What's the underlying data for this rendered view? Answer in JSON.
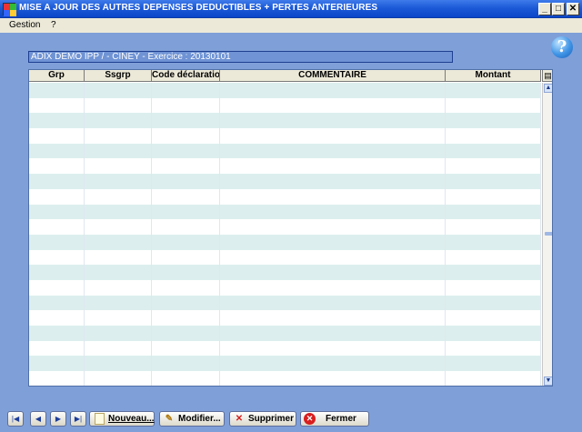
{
  "window": {
    "title": "MISE A JOUR  DES AUTRES DEPENSES DEDUCTIBLES + PERTES ANTERIEURES",
    "min_symbol": "_",
    "max_symbol": "□",
    "close_symbol": "✕"
  },
  "menu": {
    "gestion": "Gestion",
    "help": "?"
  },
  "help_icon_glyph": "?",
  "context": {
    "info": "ADIX DEMO IPP /     - CINEY - Exercice : 20130101"
  },
  "grid": {
    "columns": [
      "Grp",
      "Ssgrp",
      "Code déclaration",
      "COMMENTAIRE",
      "Montant"
    ],
    "row_count": 20,
    "column_chooser_glyph": "▤",
    "scroll_up": "▲",
    "scroll_down": "▼"
  },
  "navigation": {
    "first": "|◀",
    "prev": "◀",
    "next": "▶",
    "last": "▶|"
  },
  "buttons": {
    "new": "Nouveau...",
    "edit": "Modifier...",
    "delete": "Supprimer",
    "close": "Fermer"
  },
  "icons": {
    "new": "document-icon",
    "edit": "pencil-icon",
    "delete": "delete-x-icon",
    "close": "stop-icon"
  },
  "colors": {
    "titlebar": "#0b46c8",
    "background": "#7f9fd8",
    "row_alt": "#dcefee",
    "infobar": "#6f93d4"
  }
}
